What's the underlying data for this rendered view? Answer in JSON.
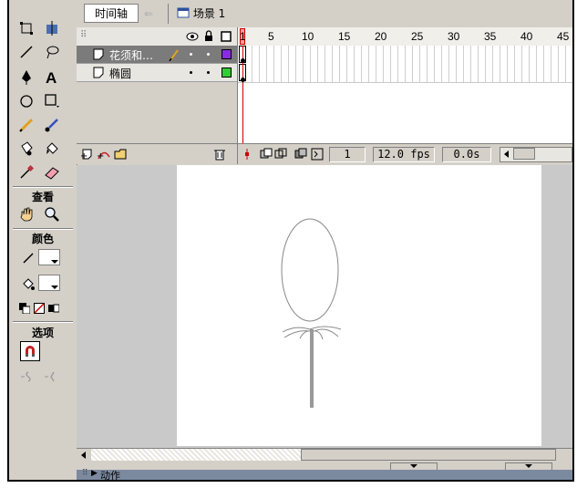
{
  "toolbar": {
    "timeline_label": "时间轴",
    "scene_label": "场景 1"
  },
  "toolbox": {
    "view_label": "查看",
    "colors_label": "颜色",
    "options_label": "选项"
  },
  "layers": [
    {
      "name": "花须和…",
      "color": "#8a2be2"
    },
    {
      "name": "椭圆",
      "color": "#33cc33"
    }
  ],
  "ruler": [
    "1",
    "5",
    "10",
    "15",
    "20",
    "25",
    "30",
    "35",
    "40",
    "45"
  ],
  "status": {
    "frame": "1",
    "fps": "12.0 fps",
    "time": "0.0s"
  },
  "panel": {
    "actions_label": "动作"
  },
  "colors": {
    "playhead": "#cc0000",
    "stage": "#ffffff",
    "pasteboard": "#c9c9c9"
  }
}
